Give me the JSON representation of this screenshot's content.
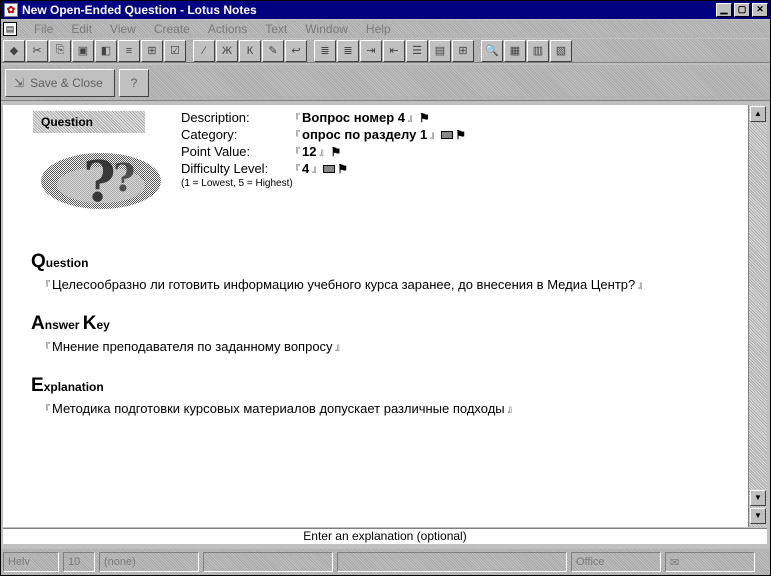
{
  "window": {
    "title": "New Open-Ended Question - Lotus Notes",
    "buttons": {
      "minimize": "▁",
      "maximize": "▢",
      "close": "✕"
    }
  },
  "menubar": {
    "items": [
      "File",
      "Edit",
      "View",
      "Create",
      "Actions",
      "Text",
      "Window",
      "Help"
    ]
  },
  "toolbar": {
    "buttons": [
      "◆",
      "✂",
      "⎘",
      "▣",
      "◧",
      "≡",
      "⊞",
      "☑",
      "⁄",
      "Ж",
      "К",
      "✎",
      "↩",
      "≣",
      "≣",
      "⇥",
      "⇤",
      "☰",
      "▤",
      "⊞",
      "🔍",
      "▦",
      "▥",
      "▧"
    ]
  },
  "actionbar": {
    "save_label": "Save & Close",
    "help_label": "?"
  },
  "form": {
    "tab_label": "Question",
    "fields": [
      {
        "label": "Description:",
        "value": "Вопрос номер 4",
        "keyword_icon": false
      },
      {
        "label": "Category:",
        "value": "опрос по разделу 1",
        "keyword_icon": true
      },
      {
        "label": "Point Value:",
        "value": "12",
        "keyword_icon": false
      },
      {
        "label": "Difficulty Level:",
        "value": "4",
        "keyword_icon": true
      }
    ],
    "difficulty_hint": "(1 = Lowest, 5 = Highest)",
    "sections": [
      {
        "cap": "Q",
        "rest": "uestion",
        "cap2": "",
        "rest2": "",
        "text": "Целесообразно ли готовить информацию учебного курса заранее, до внесения в Медиа Центр?"
      },
      {
        "cap": "A",
        "rest": "nswer ",
        "cap2": "K",
        "rest2": "ey",
        "text": "Мнение преподавателя по заданному вопросу"
      },
      {
        "cap": "E",
        "rest": "xplanation",
        "cap2": "",
        "rest2": "",
        "text": "Методика подготовки курсовых материалов допускает различные подходы"
      }
    ]
  },
  "hint_line": "Enter an explanation (optional)",
  "statusbar": {
    "cells": [
      "Helv",
      "10",
      "(none)",
      "",
      "",
      "Office"
    ]
  }
}
